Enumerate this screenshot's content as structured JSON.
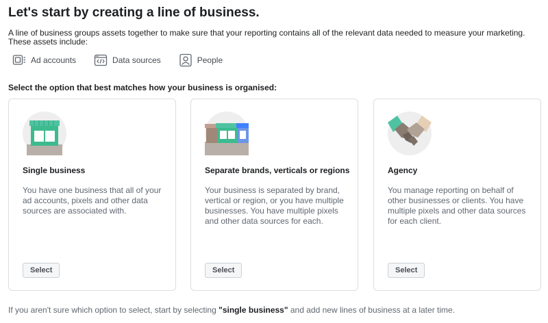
{
  "header": {
    "title": "Let's start by creating a line of business.",
    "intro": "A line of business groups assets together to make sure that your reporting contains all of the relevant data needed to measure your marketing. These assets include:"
  },
  "assets": [
    {
      "icon": "ad-accounts-icon",
      "label": "Ad accounts"
    },
    {
      "icon": "data-sources-icon",
      "label": "Data sources"
    },
    {
      "icon": "people-icon",
      "label": "People"
    }
  ],
  "prompt": "Select the option that best matches how your business is organised:",
  "options": [
    {
      "icon": "single-storefront-icon",
      "title": "Single business",
      "description": "You have one business that all of your ad accounts, pixels and other data sources are associated with.",
      "button": "Select"
    },
    {
      "icon": "multiple-storefronts-icon",
      "title": "Separate brands, verticals or regions",
      "description": "Your business is separated by brand, vertical or region, or you have multiple businesses. You have multiple pixels and other data sources for each.",
      "button": "Select"
    },
    {
      "icon": "handshake-icon",
      "title": "Agency",
      "description": "You manage reporting on behalf of other businesses or clients. You have multiple pixels and other data sources for each client.",
      "button": "Select"
    }
  ],
  "footer": {
    "before": "If you aren't sure which option to select, start by selecting ",
    "emphasis": "\"single business\"",
    "after": " and add new lines of business at a later time."
  },
  "colors": {
    "teal": "#4fc3a1",
    "storefront_green": "#3dbb8f",
    "blue_awning": "#4080ff",
    "circle_bg": "#eeeeee",
    "muted_text": "#606770"
  }
}
